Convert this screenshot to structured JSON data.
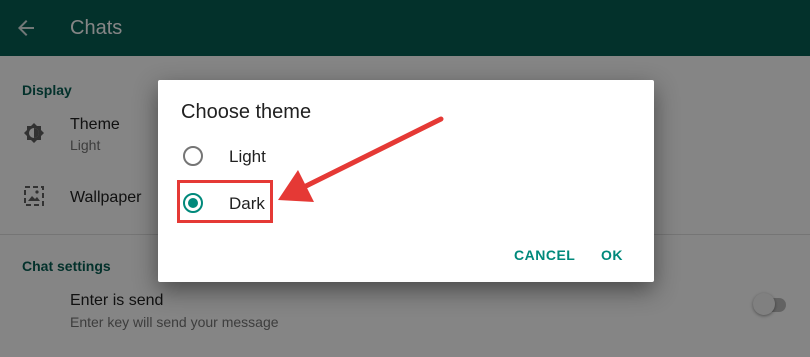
{
  "appbar": {
    "title": "Chats",
    "back_icon": "arrow-back-icon"
  },
  "display_section": {
    "header": "Display",
    "theme": {
      "title": "Theme",
      "value": "Light",
      "icon": "brightness-icon"
    },
    "wallpaper": {
      "title": "Wallpaper",
      "icon": "wallpaper-icon"
    }
  },
  "chat_settings": {
    "header": "Chat settings",
    "enter_is_send": {
      "title": "Enter is send",
      "subtitle": "Enter key will send your message",
      "enabled": false
    }
  },
  "dialog": {
    "title": "Choose theme",
    "options": [
      {
        "label": "Light",
        "selected": false
      },
      {
        "label": "Dark",
        "selected": true
      }
    ],
    "cancel_label": "CANCEL",
    "ok_label": "OK"
  },
  "colors": {
    "appbar": "#075e54",
    "accent": "#00897b",
    "annotation": "#e53935"
  }
}
